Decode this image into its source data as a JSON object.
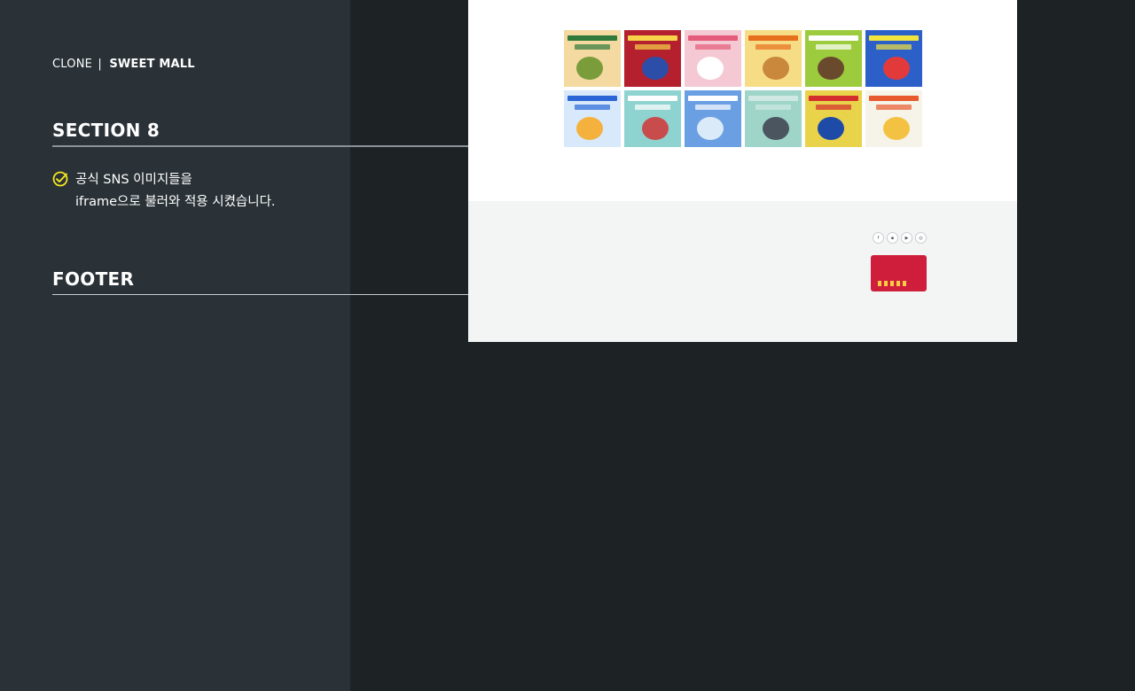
{
  "sidebar": {
    "brand_clone": "CLONE",
    "brand_sep": "|",
    "brand_name": "SWEET MALL",
    "section8_title": "SECTION 8",
    "section8_line1": "공식 SNS 이미지들을",
    "section8_line2": "iframe으로 불러와 적용 시켰습니다.",
    "footer_title": "FOOTER"
  },
  "colors": {
    "left_panel": "#2a3237",
    "background": "#1d2225",
    "check_icon": "#f2e51d",
    "badge": "#cf1e3c"
  },
  "instagram": {
    "tiles": [
      {
        "name": "sns-tile-1",
        "bg": "#f4d9a0",
        "band": "#2f7a3a",
        "blob": "#7a9c3b"
      },
      {
        "name": "sns-tile-2",
        "bg": "#b4202d",
        "band": "#f7d34a",
        "blob": "#2c4ea8"
      },
      {
        "name": "sns-tile-3",
        "bg": "#f5c9d3",
        "band": "#e45b7b",
        "blob": "#ffffff"
      },
      {
        "name": "sns-tile-4",
        "bg": "#f7dc86",
        "band": "#e56f1d",
        "blob": "#c9883c"
      },
      {
        "name": "sns-tile-5",
        "bg": "#9ccc3d",
        "band": "#ffffff",
        "blob": "#6a4a2d"
      },
      {
        "name": "sns-tile-6",
        "bg": "#2c60c8",
        "band": "#f2e33d",
        "blob": "#e23a3a"
      },
      {
        "name": "sns-tile-7",
        "bg": "#d8e9fb",
        "band": "#2a66d6",
        "blob": "#f5b13d"
      },
      {
        "name": "sns-tile-8",
        "bg": "#8fd3d0",
        "band": "#ffffff",
        "blob": "#c84c4c"
      },
      {
        "name": "sns-tile-9",
        "bg": "#6aa0e3",
        "band": "#ffffff",
        "blob": "#dbeaf8"
      },
      {
        "name": "sns-tile-10",
        "bg": "#9fd5c9",
        "band": "#cfe8e3",
        "blob": "#4a5560"
      },
      {
        "name": "sns-tile-11",
        "bg": "#e8d34a",
        "band": "#d42e2e",
        "blob": "#1e4aa8"
      },
      {
        "name": "sns-tile-12",
        "bg": "#f6f3e8",
        "band": "#e85a2d",
        "blob": "#f4c242"
      }
    ]
  }
}
